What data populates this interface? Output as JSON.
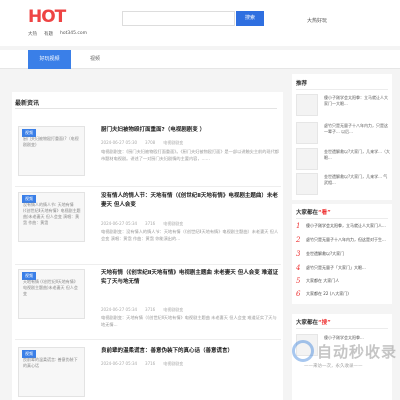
{
  "header": {
    "logo_main": "HOT",
    "logo_sub": "",
    "links": [
      "大热",
      "有题",
      "hot345.com"
    ],
    "search_placeholder": "",
    "search_button": "搜索",
    "right_link": "大热好玩"
  },
  "nav": {
    "tabs": [
      "好玩视频",
      "视频"
    ]
  },
  "main": {
    "section_title": "最新资讯",
    "articles": [
      {
        "badge": "视频",
        "thumb_text": "厨门夫妇被物殴打重面(?（电视剧剧变)",
        "title": "厨门夫妇被物殴打面重面?（电视剧剧变 ）",
        "date": "2024-06-27 05:30",
        "views": "3708",
        "category": "电视剧剧变",
        "desc": "电视剧剧变：《厨门夫妇被物殴打面重面》。《厨门夫妇被物殴打面》是一部以讲触尖主前的现代都市题材电视剧。讲述了一对厨门夫妇剧情的主要内容，……"
      },
      {
        "badge": "视频",
        "thumb_text": "没有情人的情人节: 天地有情 (《创世纪Ⅱ天地有情》电视剧主题曲)未老妻天 但人会变 演唱：黄霑 作曲：黄霑",
        "title": "没有情人的情人节：天地有情（《创世纪Ⅱ天地有情》电视剧主题曲）未老妻天 但人会变",
        "date": "2024-06-27 05:34",
        "views": "3716",
        "category": "电视剧剧变",
        "desc": "电视剧剧变：没有情人的情人节：天地有情（《创世纪Ⅱ天地有情》电视剧主题曲）未老妻天 但人会变 演唱：黄霑 作曲：黄霑 你能演出的..."
      },
      {
        "badge": "视频",
        "thumb_text": "天地有情 (《创世纪Ⅱ天地有情》电视剧主题曲)未老妻天 但人会变 ",
        "title": "天地有情（《创世纪Ⅱ天地有情》电视剧主题曲 未老妻天 但人会变 难道证实了天与地无情",
        "date": "2024-06-27 05:34",
        "views": "3716",
        "category": "电视剧剧变",
        "desc": "电视剧剧变：天地有情（《创世纪Ⅱ天地有情》电视剧主题曲 未老妻天 但人会变 难道证实了天与地无情..."
      },
      {
        "badge": "视频",
        "thumb_text": "良前辈的温柔谎言: 善意伪装下的真心话",
        "title": "良前辈的温柔谎言：善意伪装下的真心话（善意谎言）",
        "date": "2024-06-27 05:34",
        "views": "3716",
        "category": "电视剧剧变",
        "desc": ""
      }
    ]
  },
  "sidebar": {
    "rec_title": "推荐",
    "rec_items": [
      "傻小子刚学会太阳拳：立马就让人大家门—大眼...",
      "虚竹只是无量子十八年内力，只是这一辈子... 以后...",
      "金世遗解救以?大家门，几来学...（大眼...",
      "金世遗解救以?大家门，几来学... 气武相..."
    ],
    "hot_head_prefix": "大家都在",
    "hot_head_hl": "“看”",
    "hot_items": [
      "傻小子刚学会太阳拳，立马就让人大家门人...",
      "虚竹只是无量子十八年内力，但这是对于生...",
      "金世遗解救以?大家门",
      "虚竹只是无量子「大家门」大眼...",
      "大家都在 大家门人",
      "大家都在 22 (八大家门)"
    ],
    "hot_nums": [
      "1",
      "2",
      "3",
      "4",
      "5",
      "6"
    ],
    "hot2_head_prefix": "大家都在",
    "hot2_head_hl": "“搜”",
    "hot2_item": "傻小子刚学会太阳拳..."
  },
  "watermark": {
    "title": "自动秒收录",
    "sub": "——来访一次，永久收录——"
  }
}
